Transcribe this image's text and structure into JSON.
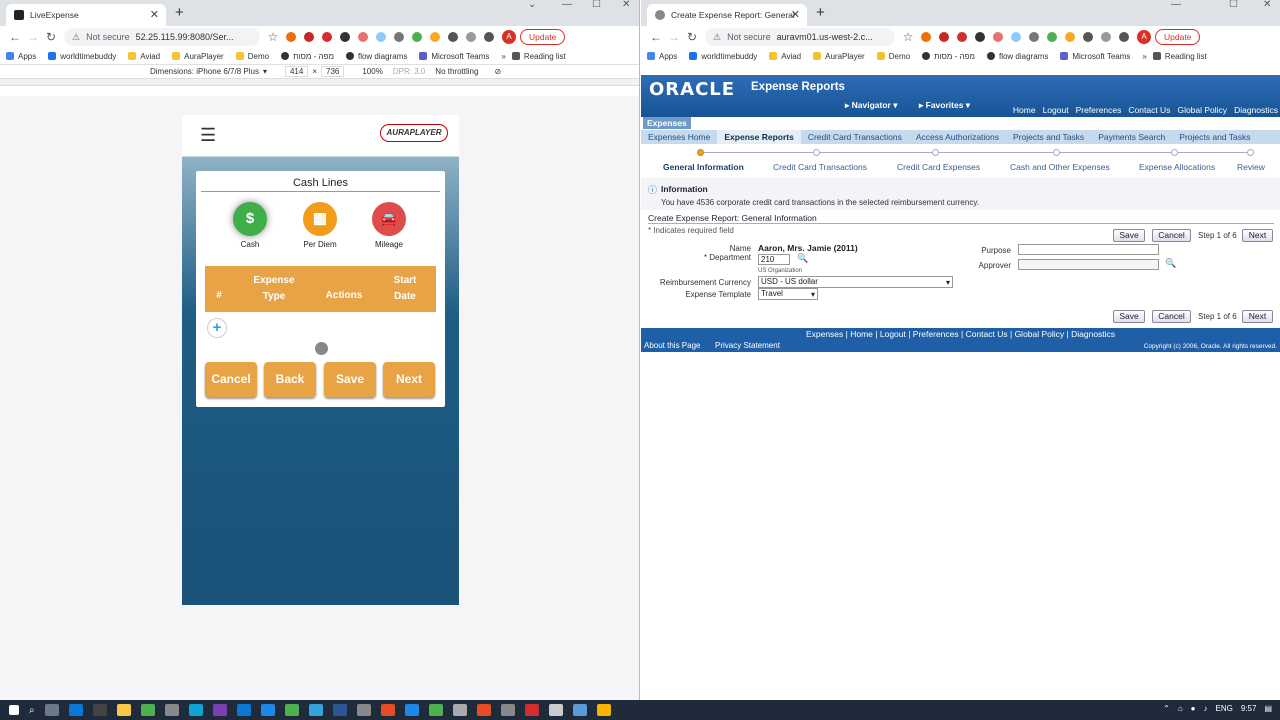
{
  "left_browser": {
    "tab_title": "LiveExpense",
    "url_secure": "Not secure",
    "url": "52.25.115.99:8080/Ser...",
    "update_label": "Update",
    "avatar_letter": "A",
    "bookmarks": [
      "Apps",
      "worldtimebuddy",
      "Aviad",
      "AuraPlayer",
      "Demo",
      "מפה - מסות",
      "flow diagrams",
      "Microsoft Teams"
    ],
    "reading_list": "Reading list",
    "devtools": {
      "dimensions": "Dimensions: iPhone 6/7/8 Plus",
      "width": "414",
      "x": "×",
      "height": "736",
      "zoom": "100%",
      "dpr": "DPR: 3.0",
      "throttle": "No throttling"
    }
  },
  "app": {
    "logo": "AURAPLAYER",
    "card_title": "Cash Lines",
    "icons": [
      {
        "label": "Cash",
        "glyph": "$",
        "color": "#3fae49"
      },
      {
        "label": "Per Diem",
        "glyph": "▦",
        "color": "#f29c1b"
      },
      {
        "label": "Mileage",
        "glyph": "🚘",
        "color": "#e04b4b"
      }
    ],
    "table_headers": {
      "num": "#",
      "type": "Expense Type",
      "actions": "Actions",
      "date": "Start Date"
    },
    "add": "+",
    "buttons": {
      "cancel": "Cancel",
      "back": "Back",
      "save": "Save",
      "next": "Next"
    }
  },
  "right_browser": {
    "tab_title": "Create Expense Report: General",
    "url_secure": "Not secure",
    "url": "auravm01.us-west-2.c...",
    "update_label": "Update",
    "avatar_letter": "A",
    "bookmarks": [
      "Apps",
      "worldtimebuddy",
      "Aviad",
      "AuraPlayer",
      "Demo",
      "מפה - מסות",
      "flow diagrams",
      "Microsoft Teams"
    ],
    "reading_list": "Reading list"
  },
  "oracle": {
    "brand": "ORACLE",
    "app_name": "Expense Reports",
    "navigator": "Navigator",
    "favorites": "Favorites",
    "top_links": [
      "Home",
      "Logout",
      "Preferences",
      "Contact Us",
      "Global Policy",
      "Diagnostics"
    ],
    "section_label": "Expenses",
    "tabs": [
      "Expenses Home",
      "Expense Reports",
      "Credit Card Transactions",
      "Access Authorizations",
      "Projects and Tasks",
      "Payments Search",
      "Projects and Tasks"
    ],
    "train": [
      "General Information",
      "Credit Card Transactions",
      "Credit Card Expenses",
      "Cash and Other Expenses",
      "Expense Allocations",
      "Review"
    ],
    "info_title": "Information",
    "info_msg": "You have 4536 corporate credit card transactions in the selected reimbursement currency.",
    "page_title": "Create Expense Report: General Information",
    "required_note": "* Indicates required field",
    "save": "Save",
    "cancel": "Cancel",
    "step": "Step 1 of 6",
    "next": "Next",
    "form": {
      "name_label": "Name",
      "name_value": "Aaron, Mrs. Jamie (2011)",
      "dept_label": "* Department",
      "dept_value": "210",
      "dept_hint": "US Organization",
      "currency_label": "Reimbursement Currency",
      "currency_value": "USD - US dollar",
      "template_label": "Expense Template",
      "template_value": "Travel",
      "purpose_label": "Purpose",
      "approver_label": "Approver"
    },
    "footer_links": [
      "Expenses",
      "Home",
      "Logout",
      "Preferences",
      "Contact Us",
      "Global Policy",
      "Diagnostics"
    ],
    "about": "About this Page",
    "privacy": "Privacy Statement",
    "copyright": "Copyright (c) 2006, Oracle. All rights reserved."
  },
  "taskbar": {
    "lang": "ENG",
    "time": "9:57"
  }
}
